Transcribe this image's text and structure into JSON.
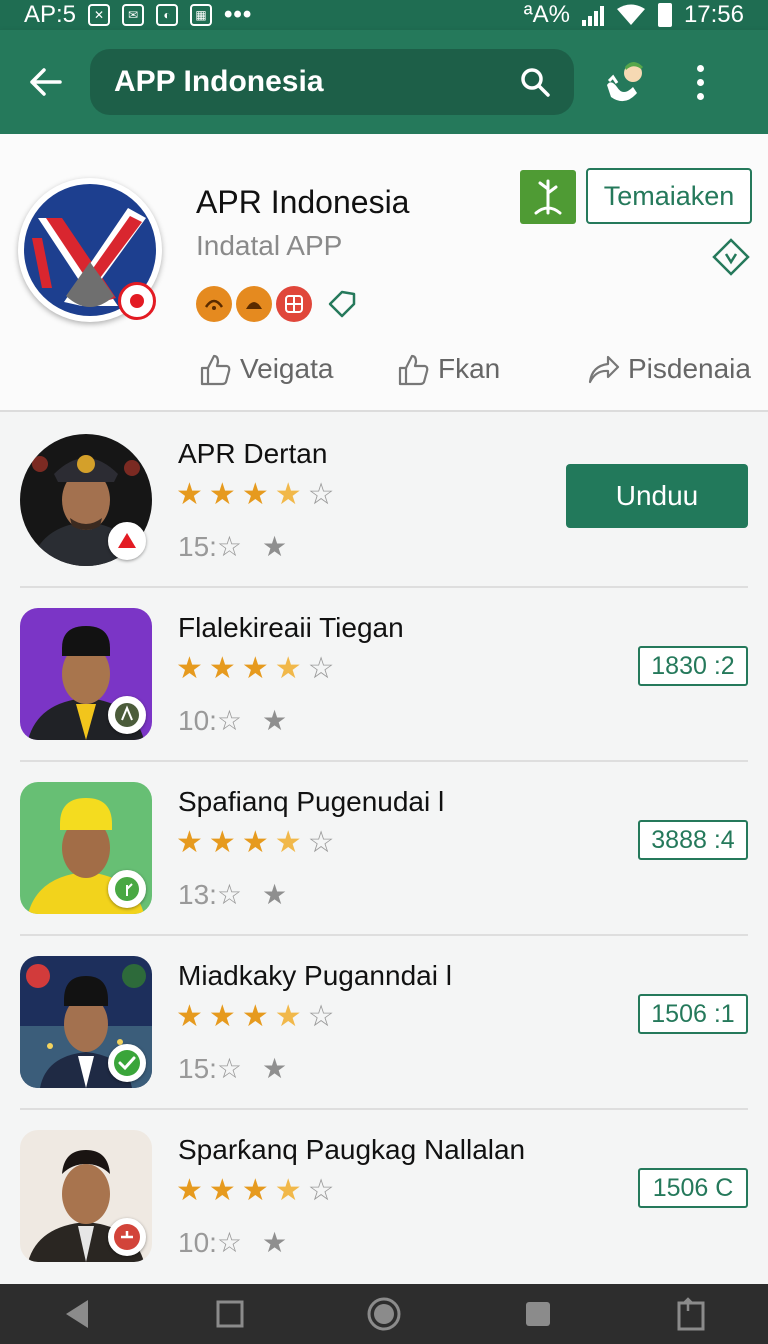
{
  "status_bar": {
    "left_text": "AP:5",
    "dots": "•••",
    "right_text": "ªA%",
    "time": "17:56"
  },
  "search": {
    "query": "APP Indonesia"
  },
  "app": {
    "title": "APR Indonesia",
    "subtitle": "Indatal APP",
    "follow_label": "Temaiaken",
    "actions": [
      {
        "label": "Veigata",
        "icon": "thumbs-up-icon"
      },
      {
        "label": "Fkan",
        "icon": "thumbs-up-icon"
      },
      {
        "label": "Pisdenaia",
        "icon": "share-icon"
      }
    ]
  },
  "colors": {
    "primary": "#25795b",
    "primary_dark": "#1f6d52",
    "star": "#e69a1e",
    "accent_red": "#e31b23"
  },
  "list": [
    {
      "name": "APR Dertan",
      "rating": 3.5,
      "meta": "15:☆",
      "action": "Unduu",
      "action_type": "button"
    },
    {
      "name": "Flalekireaii Tiegan",
      "rating": 3.5,
      "meta": "10:☆",
      "action": "1830 :2",
      "action_type": "price"
    },
    {
      "name": "Spafianq Pugenudai l",
      "rating": 3.5,
      "meta": "13:☆",
      "action": "3888 :4",
      "action_type": "price"
    },
    {
      "name": "Miadkaky Puganndai l",
      "rating": 3.5,
      "meta": "15:☆",
      "action": "1506 :1",
      "action_type": "price"
    },
    {
      "name": "Sparƙanq Paugkag Nallalan",
      "rating": 3.5,
      "meta": "10:☆",
      "action": "1506 C",
      "action_type": "price"
    }
  ]
}
